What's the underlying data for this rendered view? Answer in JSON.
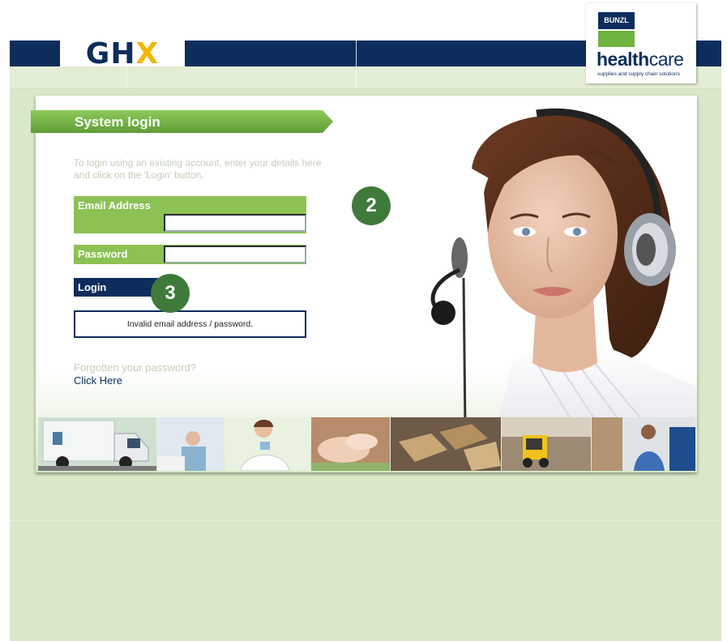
{
  "brand": {
    "ghx_logo_text": "GHX",
    "partner_logo_box": "BUNZL",
    "partner_logo_word_bold": "health",
    "partner_logo_word_light": "care",
    "partner_tagline": "supplies and supply chain solutions"
  },
  "login": {
    "title": "System login",
    "intro": "To login using an existing account, enter your details here and click on the 'Login' button.",
    "email_label": "Email Address",
    "email_value": "",
    "password_label": "Password",
    "password_value": "",
    "login_button": "Login",
    "error_message": "Invalid email address / password.",
    "forgot_text": "Forgotten your password?",
    "forgot_link": "Click Here"
  },
  "markers": {
    "step_2": "2",
    "step_3": "3"
  },
  "colors": {
    "navy": "#0d2d5c",
    "green": "#8cc153",
    "marker_green": "#3f7a3a",
    "page_bg": "#d9e8c9"
  }
}
